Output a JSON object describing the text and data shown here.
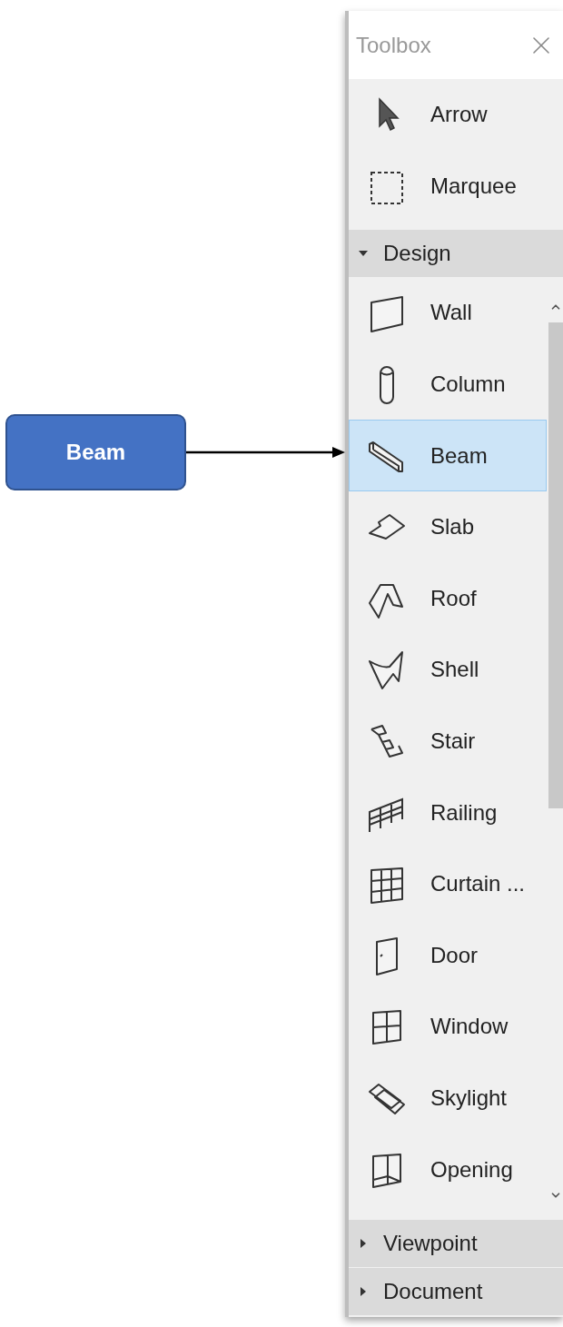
{
  "callout": {
    "label": "Beam"
  },
  "toolbox": {
    "title": "Toolbox",
    "top_tools": [
      {
        "label": "Arrow",
        "kind": "arrow",
        "selected": false
      },
      {
        "label": "Marquee",
        "kind": "marquee",
        "selected": false
      }
    ],
    "groups": [
      {
        "label": "Design",
        "expanded": true,
        "tools": [
          {
            "label": "Wall",
            "kind": "wall",
            "selected": false
          },
          {
            "label": "Column",
            "kind": "column",
            "selected": false
          },
          {
            "label": "Beam",
            "kind": "beam",
            "selected": true
          },
          {
            "label": "Slab",
            "kind": "slab",
            "selected": false
          },
          {
            "label": "Roof",
            "kind": "roof",
            "selected": false
          },
          {
            "label": "Shell",
            "kind": "shell",
            "selected": false
          },
          {
            "label": "Stair",
            "kind": "stair",
            "selected": false
          },
          {
            "label": "Railing",
            "kind": "railing",
            "selected": false
          },
          {
            "label": "Curtain ...",
            "kind": "curtain",
            "selected": false
          },
          {
            "label": "Door",
            "kind": "door",
            "selected": false
          },
          {
            "label": "Window",
            "kind": "window",
            "selected": false
          },
          {
            "label": "Skylight",
            "kind": "skylight",
            "selected": false
          },
          {
            "label": "Opening",
            "kind": "opening",
            "selected": false
          }
        ]
      },
      {
        "label": "Viewpoint",
        "expanded": false
      },
      {
        "label": "Document",
        "expanded": false
      }
    ]
  }
}
